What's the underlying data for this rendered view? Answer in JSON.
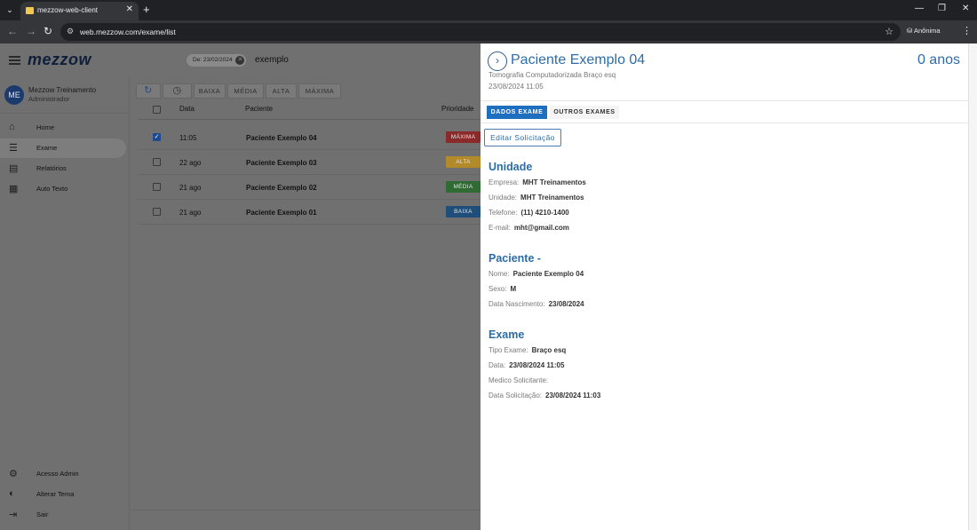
{
  "browser": {
    "tab_title": "mezzow-web-client",
    "url": "web.mezzow.com/exame/list",
    "profile_label": "Anônima"
  },
  "header": {
    "logo": "mezzow",
    "date_chip": "De: 23/02/2024",
    "search_value": "exemplo"
  },
  "user": {
    "initials": "ME",
    "name": "Mezzow Treinamento",
    "role": "Administrador"
  },
  "sidebar": {
    "items": [
      {
        "label": "Home",
        "icon": "home-icon"
      },
      {
        "label": "Exame",
        "icon": "list-icon",
        "active": true
      },
      {
        "label": "Relatórios",
        "icon": "report-icon"
      },
      {
        "label": "Auto Texto",
        "icon": "text-icon"
      }
    ],
    "bottom_items": [
      {
        "label": "Acesso Admin",
        "icon": "gear-icon"
      },
      {
        "label": "Alterar Tema",
        "icon": "theme-icon"
      },
      {
        "label": "Sair",
        "icon": "logout-icon"
      }
    ]
  },
  "filters": {
    "baixa": "BAIXA",
    "media": "MÉDIA",
    "alta": "ALTA",
    "maxima": "MÁXIMA"
  },
  "table": {
    "headers": {
      "data": "Data",
      "paciente": "Paciente",
      "prioridade": "Prioridade"
    },
    "rows": [
      {
        "data": "11:05",
        "paciente": "Paciente Exemplo 04",
        "prioridade": "MÁXIMA",
        "color": "#8a2a2a",
        "checked": true
      },
      {
        "data": "22 ago",
        "paciente": "Paciente Exemplo 03",
        "prioridade": "ALTA",
        "color": "#b38a2a",
        "checked": false
      },
      {
        "data": "21 ago",
        "paciente": "Paciente Exemplo 02",
        "prioridade": "MÉDIA",
        "color": "#2f6b33",
        "checked": false
      },
      {
        "data": "21 ago",
        "paciente": "Paciente Exemplo 01",
        "prioridade": "BAIXA",
        "color": "#1f4e7a",
        "checked": false
      }
    ]
  },
  "panel": {
    "title": "Paciente Exemplo 04",
    "age": "0 anos",
    "subtitle": "Tomografia Computadorizada Braço esq",
    "datetime": "23/08/2024 11:05",
    "tabs": {
      "dados": "DADOS EXAME",
      "outros": "OUTROS EXAMES"
    },
    "edit_label": "Editar Solicitação",
    "unidade": {
      "title": "Unidade",
      "empresa_label": "Empresa:",
      "empresa": "MHT Treinamentos",
      "unidade_label": "Unidade:",
      "unidade": "MHT Treinamentos",
      "telefone_label": "Telefone:",
      "telefone": "(11) 4210-1400",
      "email_label": "E-mail:",
      "email": "mht@gmail.com"
    },
    "paciente": {
      "title": "Paciente -",
      "nome_label": "Nome:",
      "nome": "Paciente Exemplo 04",
      "sexo_label": "Sexo:",
      "sexo": "M",
      "nasc_label": "Data Nascimento:",
      "nasc": "23/08/2024"
    },
    "exame": {
      "title": "Exame",
      "tipo_label": "Tipo Exame:",
      "tipo": "Braço esq",
      "data_label": "Data:",
      "data": "23/08/2024 11:05",
      "medico_label": "Medico Solicitante:",
      "medico": "",
      "solic_label": "Data Solicitação:",
      "solic": "23/08/2024 11:03"
    }
  }
}
